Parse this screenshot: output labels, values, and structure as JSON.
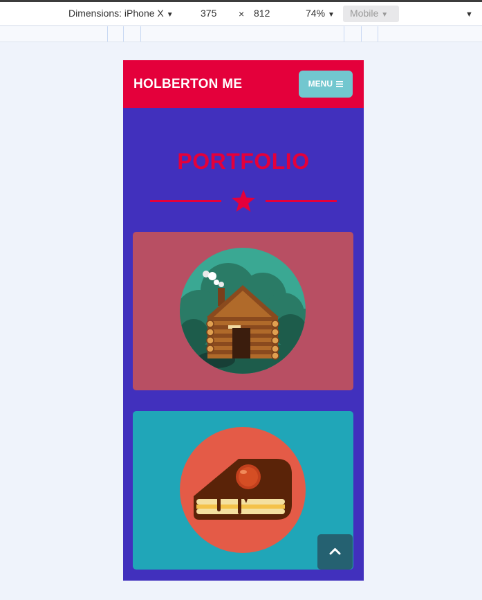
{
  "devtools": {
    "dimensions_label": "Dimensions: iPhone X",
    "width": "375",
    "times": "×",
    "height": "812",
    "zoom": "74%",
    "mode": "Mobile"
  },
  "site": {
    "brand": "HOLBERTON ME",
    "menu_label": "MENU",
    "menu_icon": "hamburger-icon",
    "section_title": "PORTFOLIO",
    "cards": [
      {
        "image": "log-cabin-illustration"
      },
      {
        "image": "cake-slice-illustration"
      }
    ],
    "back_to_top_icon": "chevron-up-icon"
  },
  "colors": {
    "header": "#e4003b",
    "page_bg": "#4130bd",
    "menu_button": "#72c7cf",
    "card_cabin": "#b84f63",
    "card_cake": "#20a6b8",
    "back_to_top": "#256171"
  }
}
